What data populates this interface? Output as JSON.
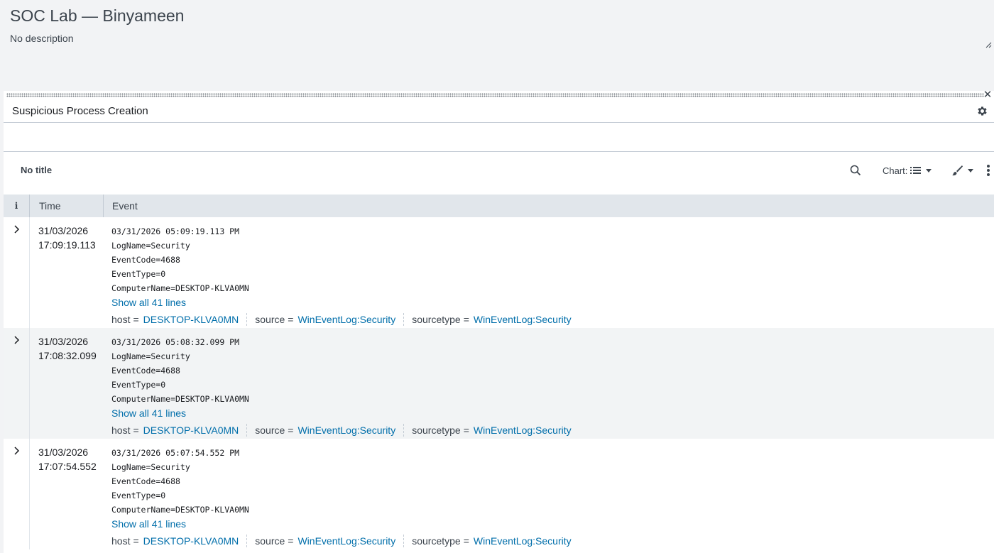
{
  "dashboard": {
    "title": "SOC Lab — Binyameen",
    "description": "No description"
  },
  "panel": {
    "title": "Suspicious Process Creation",
    "viz_title": "No title",
    "toolbar": {
      "chart_label": "Chart:"
    }
  },
  "table": {
    "columns": {
      "info": "i",
      "time": "Time",
      "event": "Event"
    },
    "rows": [
      {
        "date": "31/03/2026",
        "time": "17:09:19.113",
        "lines": [
          "03/31/2026 05:09:19.113 PM",
          "LogName=Security",
          "EventCode=4688",
          "EventType=0",
          "ComputerName=DESKTOP-KLVA0MN"
        ],
        "show_all": "Show all 41 lines",
        "fields": [
          {
            "key": "host",
            "value": "DESKTOP-KLVA0MN"
          },
          {
            "key": "source",
            "value": "WinEventLog:Security"
          },
          {
            "key": "sourcetype",
            "value": "WinEventLog:Security"
          }
        ]
      },
      {
        "date": "31/03/2026",
        "time": "17:08:32.099",
        "lines": [
          "03/31/2026 05:08:32.099 PM",
          "LogName=Security",
          "EventCode=4688",
          "EventType=0",
          "ComputerName=DESKTOP-KLVA0MN"
        ],
        "show_all": "Show all 41 lines",
        "fields": [
          {
            "key": "host",
            "value": "DESKTOP-KLVA0MN"
          },
          {
            "key": "source",
            "value": "WinEventLog:Security"
          },
          {
            "key": "sourcetype",
            "value": "WinEventLog:Security"
          }
        ]
      },
      {
        "date": "31/03/2026",
        "time": "17:07:54.552",
        "lines": [
          "03/31/2026 05:07:54.552 PM",
          "LogName=Security",
          "EventCode=4688",
          "EventType=0",
          "ComputerName=DESKTOP-KLVA0MN"
        ],
        "show_all": "Show all 41 lines",
        "fields": [
          {
            "key": "host",
            "value": "DESKTOP-KLVA0MN"
          },
          {
            "key": "source",
            "value": "WinEventLog:Security"
          },
          {
            "key": "sourcetype",
            "value": "WinEventLog:Security"
          }
        ]
      }
    ]
  },
  "icons": {
    "close": "close-icon",
    "gear": "gear-icon",
    "search": "search-icon",
    "list": "list-icon",
    "brush": "brush-icon",
    "more": "more-vertical-icon",
    "expand": "chevron-right-icon"
  },
  "colors": {
    "link": "#006eaa",
    "header_bg": "#e1e6eb",
    "page_bg": "#f2f3f5"
  }
}
